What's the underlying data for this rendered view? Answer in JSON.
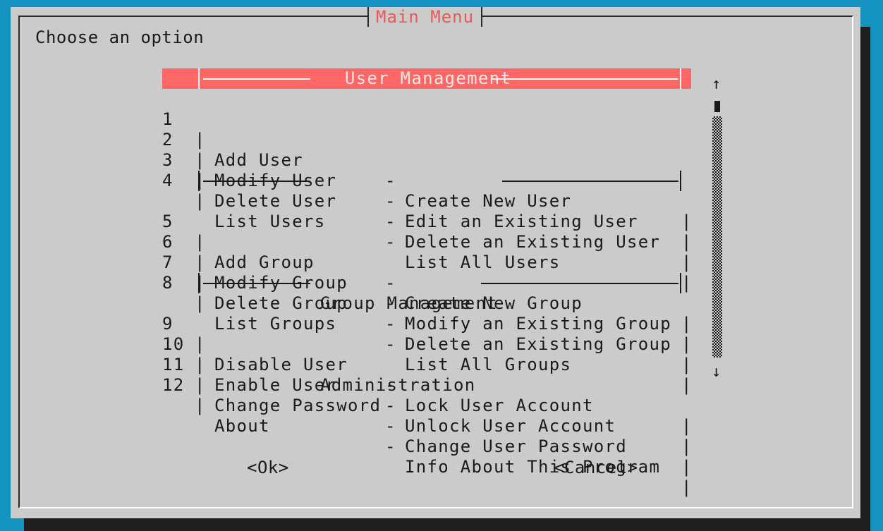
{
  "dialog": {
    "title": "Main Menu",
    "prompt": "Choose an option"
  },
  "menu": {
    "sections": [
      {
        "header": "User Management"
      },
      {
        "header": "Group Management"
      },
      {
        "header": "Administration"
      }
    ],
    "items": [
      {
        "num": "1",
        "name": "Add User",
        "desc": "Create New User"
      },
      {
        "num": "2",
        "name": "Modify User",
        "desc": "Edit an Existing User"
      },
      {
        "num": "3",
        "name": "Delete User",
        "desc": "Delete an Existing User"
      },
      {
        "num": "4",
        "name": "List Users",
        "desc": "List All Users"
      },
      {
        "num": "5",
        "name": "Add Group",
        "desc": "Create New Group"
      },
      {
        "num": "6",
        "name": "Modify Group",
        "desc": "Modify an Existing Group"
      },
      {
        "num": "7",
        "name": "Delete Group",
        "desc": "Delete an Existing Group"
      },
      {
        "num": "8",
        "name": "List Groups",
        "desc": "List All Groups"
      },
      {
        "num": "9",
        "name": "Disable User",
        "desc": "Lock User Account"
      },
      {
        "num": "10",
        "name": "Enable User",
        "desc": "Unlock User Account"
      },
      {
        "num": "11",
        "name": "Change Password",
        "desc": "Change User Password"
      },
      {
        "num": "12",
        "name": "About",
        "desc": "Info About This Program"
      }
    ],
    "separator_bar": "|",
    "separator_dash": "-"
  },
  "scrollbar": {
    "up_arrow": "↑",
    "down_arrow": "↓"
  },
  "buttons": {
    "ok": "<Ok>",
    "cancel": "<Cancel>"
  },
  "colors": {
    "background": "#1493c0",
    "dialog": "#cbcbcb",
    "title": "#e85a5a",
    "selection": "#ff6666"
  }
}
